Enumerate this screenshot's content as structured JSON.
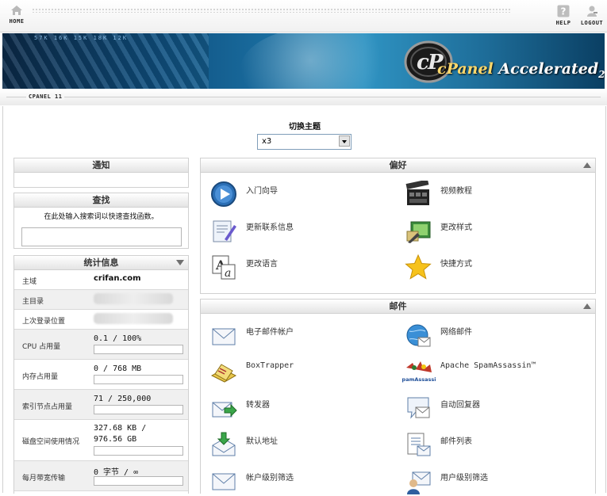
{
  "topbar": {
    "home_label": "HOME",
    "help_label": "HELP",
    "logout_label": "LOGOUT"
  },
  "banner": {
    "brand": "cPanel",
    "brand_suffix": "Accelerated",
    "brand_version": "2",
    "ticker": "57K 16K 15K 18K 12K"
  },
  "version_label": "CPANEL 11",
  "theme": {
    "title": "切换主题",
    "selected": "x3"
  },
  "notices": {
    "title": "通知"
  },
  "find": {
    "title": "查找",
    "description": "在此处输入搜索词以快速查找函数。",
    "value": ""
  },
  "stats": {
    "title": "统计信息",
    "rows": [
      {
        "label": "主域",
        "value": "crifan.com"
      },
      {
        "label": "主目录",
        "value": ""
      },
      {
        "label": "上次登录位置",
        "value": ""
      },
      {
        "label": "CPU 占用量",
        "value": "0.1 / 100%",
        "usage": 0.001
      },
      {
        "label": "内存占用量",
        "value": "0 / 768 MB",
        "usage": 0
      },
      {
        "label": "索引节点占用量",
        "value": "71 / 250,000",
        "usage": 0.0003
      },
      {
        "label": "磁盘空间使用情况",
        "value_line1": "327.68 KB /",
        "value_line2": "976.56 GB",
        "usage": 0
      },
      {
        "label": "每月带宽传输",
        "value": "0 字节 / ∞",
        "usage": 0
      }
    ]
  },
  "preferences": {
    "title": "偏好",
    "items": [
      {
        "label": "入门向导",
        "icon": "play-icon"
      },
      {
        "label": "视频教程",
        "icon": "film-icon"
      },
      {
        "label": "更新联系信息",
        "icon": "contact-info-icon"
      },
      {
        "label": "更改样式",
        "icon": "style-icon"
      },
      {
        "label": "更改语言",
        "icon": "language-icon"
      },
      {
        "label": "快捷方式",
        "icon": "star-icon"
      }
    ]
  },
  "mail": {
    "title": "邮件",
    "items": [
      {
        "label": "电子邮件帐户",
        "icon": "envelope-icon"
      },
      {
        "label": "网络邮件",
        "icon": "webmail-icon"
      },
      {
        "label": "BoxTrapper",
        "icon": "boxtrapper-icon"
      },
      {
        "label": "Apache SpamAssassin™",
        "icon": "spamassassin-icon",
        "icon_text": "SpamAssassin"
      },
      {
        "label": "转发器",
        "icon": "forwarder-icon"
      },
      {
        "label": "自动回复器",
        "icon": "autoresponder-icon"
      },
      {
        "label": "默认地址",
        "icon": "default-address-icon"
      },
      {
        "label": "邮件列表",
        "icon": "mailing-list-icon"
      },
      {
        "label": "帐户级别筛选",
        "icon": "account-filter-icon"
      },
      {
        "label": "用户级别筛选",
        "icon": "user-filter-icon"
      }
    ]
  },
  "colors": {
    "panel_header": "#e4e4e4",
    "banner_dark": "#0c2b4a",
    "banner_light": "#2f93c2",
    "usage_bar": "#6da3d6"
  }
}
